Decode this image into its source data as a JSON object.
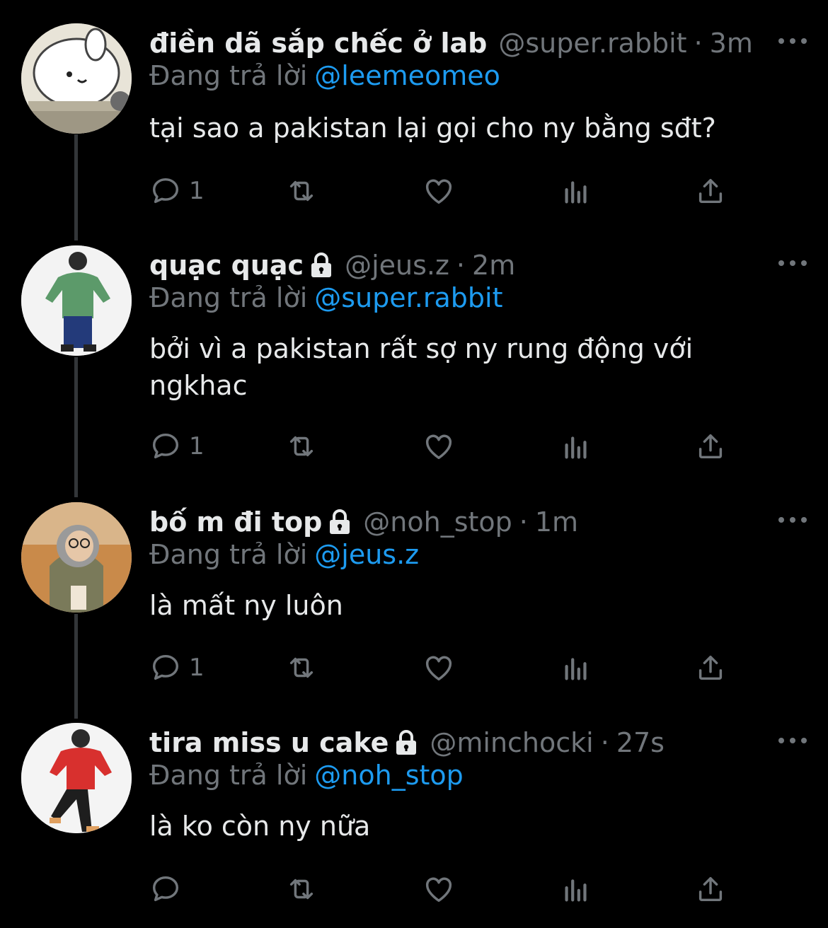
{
  "reply_prefix": "Đang trả lời",
  "colors": {
    "background": "#000000",
    "text": "#e7e9ea",
    "muted": "#71767b",
    "link": "#1d9bf0",
    "thread_line": "#333639"
  },
  "tweets": [
    {
      "display_name": "điền dã sắp chếc ở lab",
      "locked": false,
      "handle": "@super.rabbit",
      "separator": "·",
      "time": "3m",
      "reply_to": "@leemeomeo",
      "text": "tại sao a pakistan lại gọi cho ny bằng sđt?",
      "reply_count": "1",
      "avatar": "cartoon-rabbit-avatar"
    },
    {
      "display_name": "quạc quạc",
      "locked": true,
      "handle": "@jeus.z",
      "separator": "·",
      "time": "2m",
      "reply_to": "@super.rabbit",
      "text": "bởi vì a pakistan rất sợ ny rung động với ngkhac",
      "reply_count": "1",
      "avatar": "person-green-hoodie-avatar"
    },
    {
      "display_name": "bố m đi top",
      "locked": true,
      "handle": "@noh_stop",
      "separator": "·",
      "time": "1m",
      "reply_to": "@jeus.z",
      "text": "là mất ny luôn",
      "reply_count": "1",
      "avatar": "person-glasses-hoodie-avatar"
    },
    {
      "display_name": "tira miss u cake",
      "locked": true,
      "handle": "@minchocki",
      "separator": "·",
      "time": "27s",
      "reply_to": "@noh_stop",
      "text": "là ko còn ny nữa",
      "reply_count": "",
      "avatar": "person-red-hoodie-avatar"
    }
  ]
}
